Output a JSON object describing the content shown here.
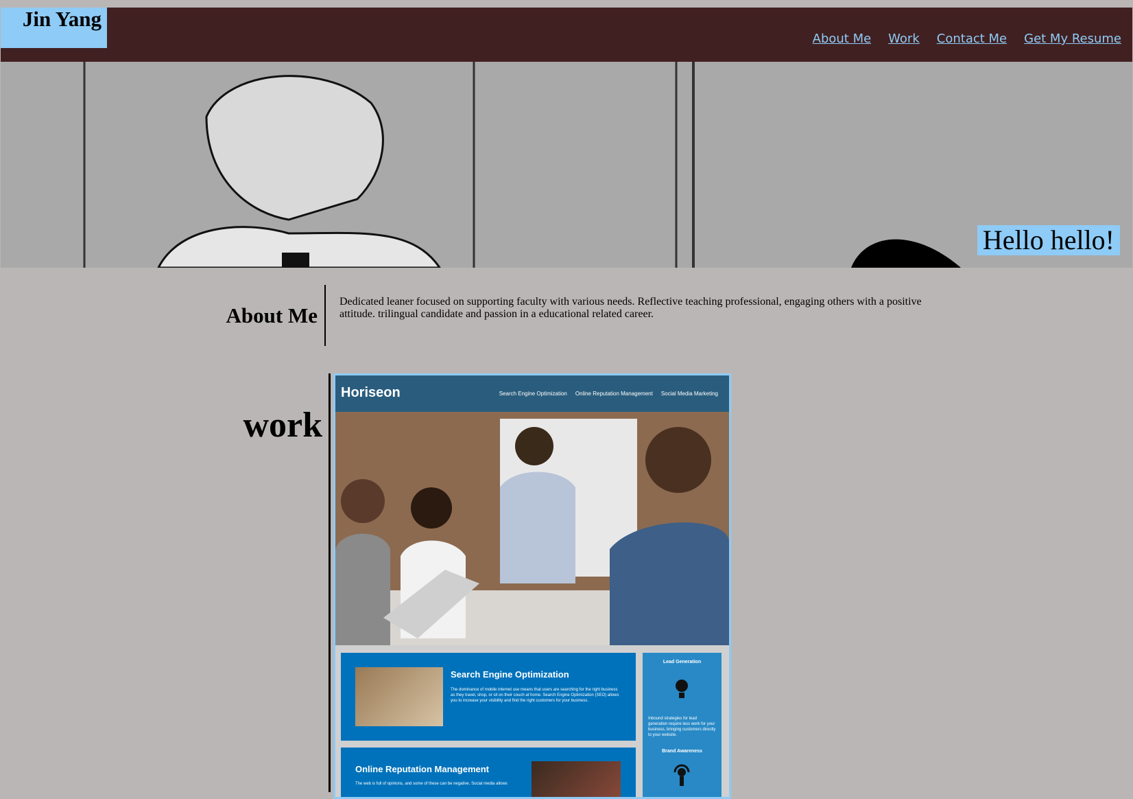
{
  "header": {
    "name": "Jin Yang",
    "nav": [
      "About Me",
      "Work",
      "Contact Me",
      "Get My Resume"
    ]
  },
  "hero": {
    "greeting": "Hello hello!"
  },
  "about": {
    "title": "About Me",
    "text": "Dedicated leaner focused on supporting faculty with various needs. Reflective teaching professional, engaging others with a positive attitude. trilingual candidate and passion in a educational related career."
  },
  "work": {
    "title": "work",
    "project": {
      "logo": "Horiseon",
      "nav": [
        "Search Engine Optimization",
        "Online Reputation Management",
        "Social Media Marketing"
      ],
      "card1_title": "Search Engine Optimization",
      "card1_text": "The dominance of mobile internet use means that users are searching for the right business as they travel, shop, or sit on their couch at home. Search Engine Optimization (SEO) allows you to increase your visibility and find the right customers for your business.",
      "side_title1": "Lead Generation",
      "side_text": "Inbound strategies for lead generation require less work for your business, bringing customers directly to your website.",
      "side_title2": "Brand Awareness",
      "card2_title": "Online Reputation Management",
      "card2_text": "The web is full of opinions, and some of these can be negative. Social media allows"
    }
  },
  "colors": {
    "header_bg": "#412021",
    "accent": "#8ecbf6",
    "page_bg": "#bab6b5"
  }
}
